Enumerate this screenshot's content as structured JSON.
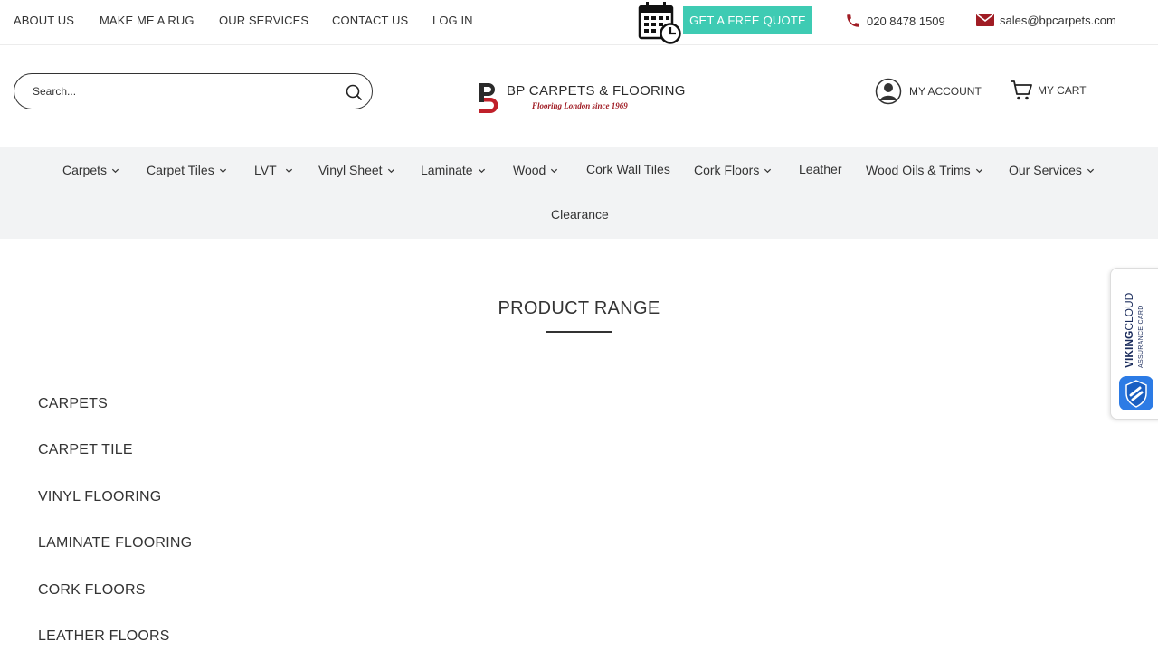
{
  "topbar": {
    "links": [
      "ABOUT US",
      "MAKE ME A RUG",
      "OUR SERVICES",
      "CONTACT US",
      "LOG IN"
    ],
    "quote_button": "GET A FREE QUOTE",
    "phone": "020 8478 1509",
    "email": "sales@bpcarpets.com"
  },
  "header": {
    "search_placeholder": "Search...",
    "logo_name": "BP CARPETS & FLOORING",
    "logo_tagline": "Flooring London since 1969",
    "account_label": "MY ACCOUNT",
    "cart_label": "MY CART"
  },
  "nav": {
    "items": [
      {
        "label": "Carpets",
        "dropdown": true
      },
      {
        "label": "Carpet Tiles",
        "dropdown": true
      },
      {
        "label": "LVT",
        "dropdown": true
      },
      {
        "label": "Vinyl Sheet",
        "dropdown": true
      },
      {
        "label": "Laminate",
        "dropdown": true
      },
      {
        "label": "Wood",
        "dropdown": true
      },
      {
        "label": "Cork Wall Tiles",
        "dropdown": false
      },
      {
        "label": "Cork Floors",
        "dropdown": true
      },
      {
        "label": "Leather",
        "dropdown": false
      },
      {
        "label": "Wood Oils & Trims",
        "dropdown": true
      },
      {
        "label": "Our Services",
        "dropdown": true
      },
      {
        "label": "Clearance",
        "dropdown": false
      }
    ]
  },
  "main": {
    "section_title": "PRODUCT RANGE",
    "product_range": [
      "CARPETS",
      "CARPET TILE",
      "VINYL FLOORING",
      "LAMINATE FLOORING",
      "CORK FLOORS",
      "LEATHER FLOORS"
    ]
  },
  "widget": {
    "brand_bold": "VIKING",
    "brand_light": "CLOUD",
    "subtitle": "ASSURANCE CARD"
  },
  "colors": {
    "accent": "#3ecbb3",
    "brand_red": "#a01c24",
    "nav_bg": "#f2f3f4",
    "text": "#333333"
  }
}
